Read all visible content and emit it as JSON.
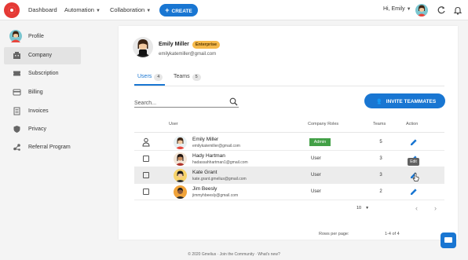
{
  "header": {
    "nav": {
      "dashboard": "Dashboard",
      "automation": "Automation",
      "collaboration": "Collaboration"
    },
    "create_label": "CREATE",
    "greeting": "Hi, Emily"
  },
  "sidebar": {
    "items": [
      {
        "label": "Profile",
        "icon": "avatar"
      },
      {
        "label": "Company",
        "icon": "building-icon"
      },
      {
        "label": "Subscription",
        "icon": "ticket-icon"
      },
      {
        "label": "Billing",
        "icon": "credit-card-icon"
      },
      {
        "label": "Invoices",
        "icon": "receipt-icon"
      },
      {
        "label": "Privacy",
        "icon": "shield-icon"
      },
      {
        "label": "Referral Program",
        "icon": "share-icon"
      }
    ]
  },
  "profile": {
    "name": "Emily Miller",
    "badge": "Enterprise",
    "email": "emilykatemiller@gmail.com"
  },
  "tabs": [
    {
      "label": "Users",
      "count": "4"
    },
    {
      "label": "Teams",
      "count": "5"
    }
  ],
  "search": {
    "placeholder": "Search..."
  },
  "invite_label": "INVITE TEAMMATES",
  "table": {
    "headers": {
      "user": "User",
      "roles": "Company Roles",
      "teams": "Teams",
      "action": "Action"
    },
    "rows": [
      {
        "name": "Emily Miller",
        "email": "emilykatemiller@gmail.com",
        "role": "Admin",
        "teams": "5"
      },
      {
        "name": "Hady Hartman",
        "email": "hadassahhartman1@gmail.com",
        "role": "User",
        "teams": "3"
      },
      {
        "name": "Kate Grant",
        "email": "kate.grant.gmelius@gmail.com",
        "role": "User",
        "teams": "3"
      },
      {
        "name": "Jim Beesly",
        "email": "jimmyhbeesly@gmail.com",
        "role": "User",
        "teams": "2"
      }
    ],
    "tooltip": "Edit"
  },
  "pagination": {
    "rows_per_page_label": "Rows per page:",
    "rows_per_page_value": "10",
    "range": "1-4 of 4"
  },
  "footer": "© 2020 Gmelius · Join the Community · What's new?",
  "colors": {
    "accent": "#1976d2",
    "admin": "#43a047",
    "enterprise": "#f5b94a",
    "brand": "#e53935"
  }
}
